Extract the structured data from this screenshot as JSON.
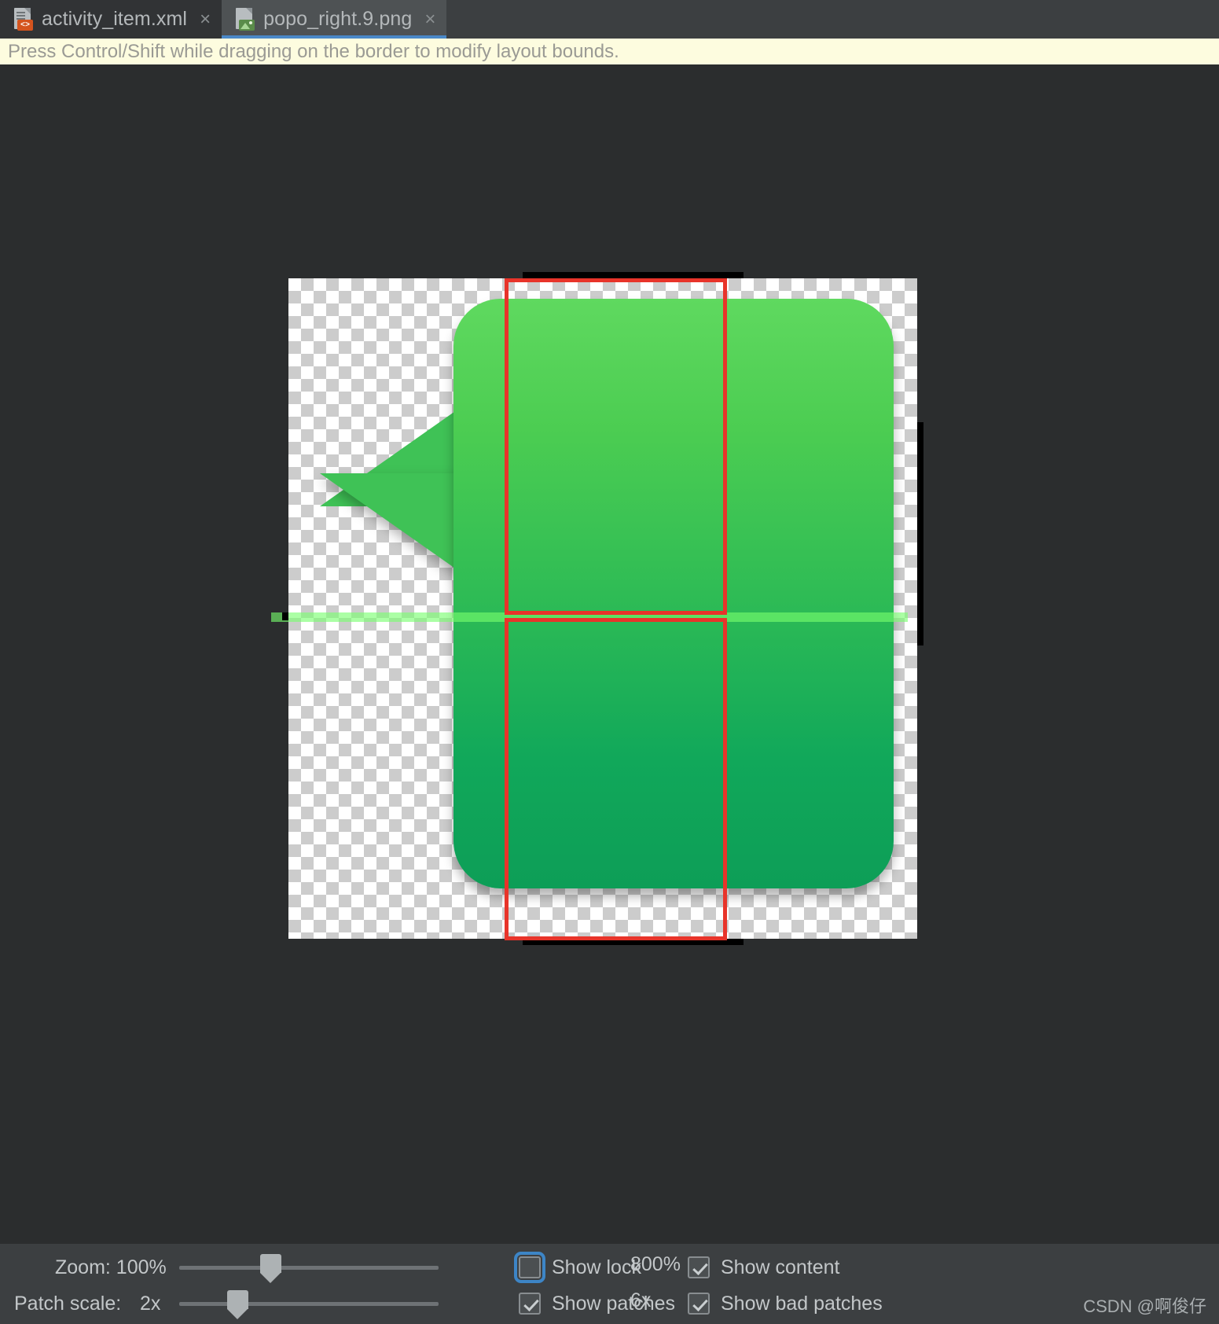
{
  "window": {
    "background": "#2b2d2e",
    "panel_background": "#3c3f41"
  },
  "tabs": [
    {
      "label": "activity_item.xml",
      "icon": "xml-file-icon",
      "badge": "<>",
      "active": false,
      "close": "×"
    },
    {
      "label": "popo_right.9.png",
      "icon": "png-file-icon",
      "badge": "img",
      "active": true,
      "close": "×"
    }
  ],
  "hint": {
    "text": "Press Control/Shift while dragging on the border to modify layout bounds.",
    "background": "#fdfcdf",
    "color": "#9a9a94"
  },
  "editor": {
    "name": "nine-patch-editor-canvas",
    "image_name": "popo_right.9.png",
    "transparency_checker": true,
    "patch_outline_color": "#e8342a",
    "stretch_marker_color": "#000000",
    "content_line_color": "#78ff6e",
    "bubble_colors": {
      "top": "#5fd95f",
      "mid": "#2fbc55",
      "bottom": "#0d9e57",
      "tail": "#3fc256"
    }
  },
  "controls": {
    "zoom": {
      "label": "Zoom: 100%",
      "value_text": "100%",
      "max_label": "800%",
      "slider_percent": 33
    },
    "patch_scale": {
      "label": "Patch scale:",
      "value_text": "2x",
      "max_label": "6x",
      "slider_percent": 20
    },
    "checkboxes": [
      {
        "label": "Show lock",
        "checked": false,
        "focused": true
      },
      {
        "label": "Show content",
        "checked": true,
        "focused": false
      },
      {
        "label": "Show patches",
        "checked": true,
        "focused": false
      },
      {
        "label": "Show bad patches",
        "checked": true,
        "focused": false
      }
    ]
  },
  "watermark": {
    "text": "CSDN @啊俊仔"
  }
}
